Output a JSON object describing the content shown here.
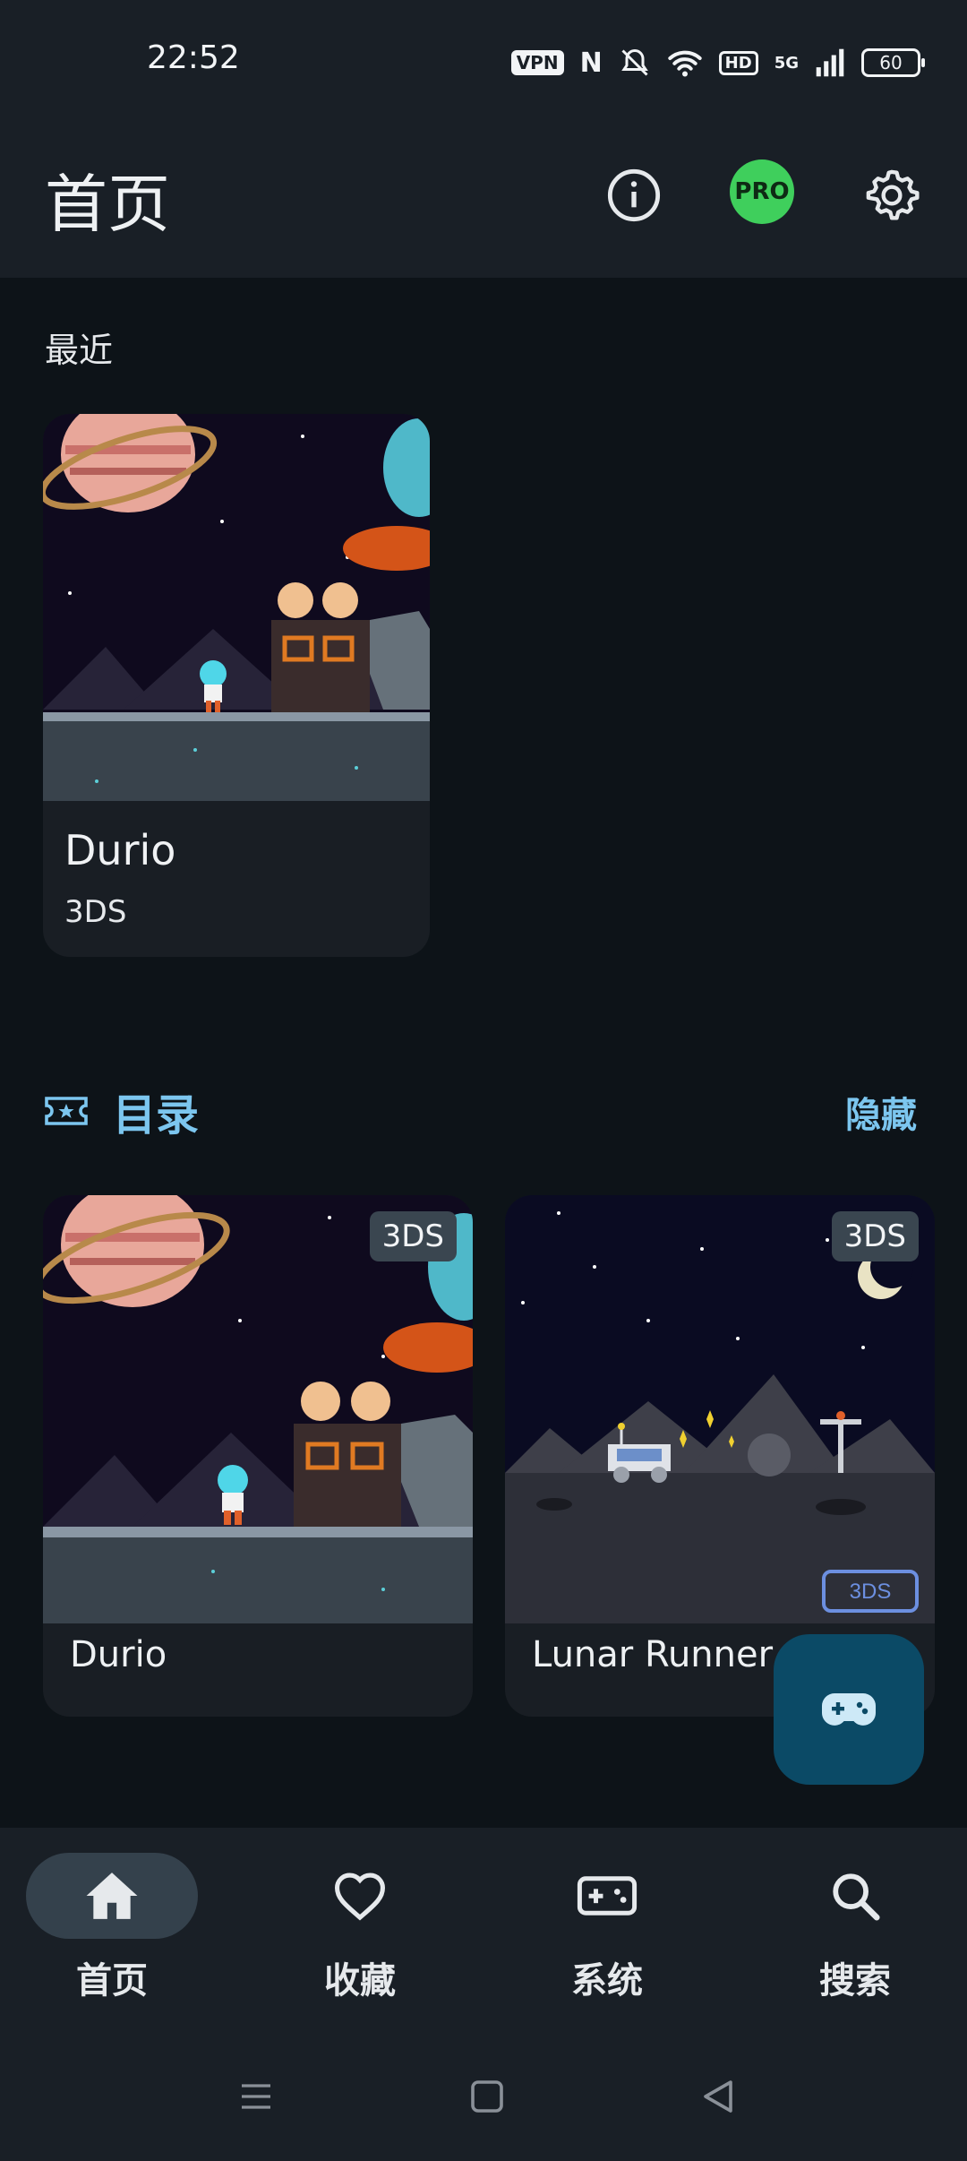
{
  "status_bar": {
    "time": "22:52",
    "vpn": "VPN",
    "nfc": "N",
    "hd": "HD",
    "network": "5G",
    "battery": "60"
  },
  "app_bar": {
    "title": "首页",
    "pro_label": "PRO",
    "icons": [
      "info-icon",
      "settings-icon"
    ]
  },
  "recent": {
    "label": "最近",
    "items": [
      {
        "name": "Durio",
        "platform": "3DS"
      }
    ]
  },
  "catalog": {
    "title": "目录",
    "hide_label": "隐藏",
    "items": [
      {
        "name": "Durio",
        "badge": "3DS"
      },
      {
        "name": "Lunar Runner",
        "badge": "3DS",
        "inner_badge": "3DS"
      }
    ]
  },
  "bottom_nav": {
    "items": [
      {
        "label": "首页",
        "icon": "home-icon",
        "active": true
      },
      {
        "label": "收藏",
        "icon": "heart-icon",
        "active": false
      },
      {
        "label": "系统",
        "icon": "gamepad-icon",
        "active": false
      },
      {
        "label": "搜索",
        "icon": "search-icon",
        "active": false
      }
    ]
  },
  "colors": {
    "accent": "#7cc6ef",
    "pro": "#3fcf5c",
    "fab": "#0b4a66",
    "surface": "#191f26",
    "background": "#0d1318"
  }
}
